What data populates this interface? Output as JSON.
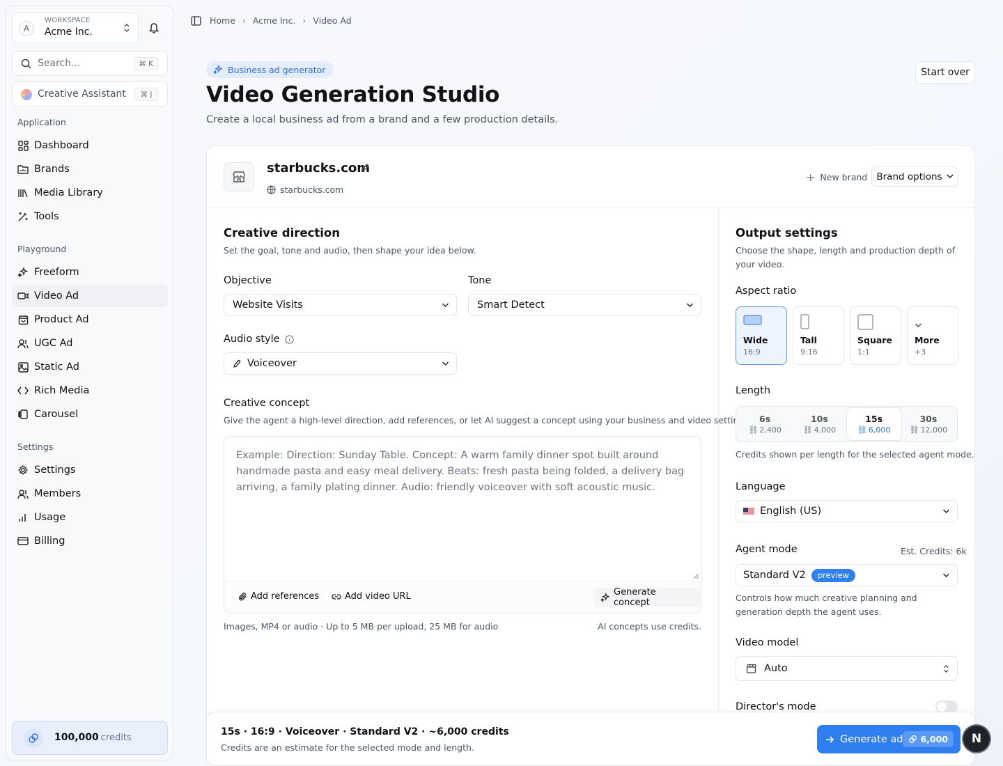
{
  "workspace": {
    "label": "WORKSPACE",
    "name": "Acme Inc.",
    "avatar": "A"
  },
  "search": {
    "placeholder": "Search...",
    "shortcut": "⌘ K"
  },
  "assistant": {
    "label": "Creative Assistant",
    "shortcut": "⌘ J"
  },
  "sidebar": {
    "application": {
      "title": "Application",
      "items": [
        {
          "label": "Dashboard",
          "icon": "dashboard-icon"
        },
        {
          "label": "Brands",
          "icon": "folder-icon"
        },
        {
          "label": "Media Library",
          "icon": "library-icon"
        },
        {
          "label": "Tools",
          "icon": "wand-icon"
        }
      ]
    },
    "playground": {
      "title": "Playground",
      "items": [
        {
          "label": "Freeform",
          "icon": "sparkles-icon"
        },
        {
          "label": "Video Ad",
          "icon": "video-icon",
          "active": true
        },
        {
          "label": "Product Ad",
          "icon": "bag-icon"
        },
        {
          "label": "UGC Ad",
          "icon": "users-icon"
        },
        {
          "label": "Static Ad",
          "icon": "image-icon"
        },
        {
          "label": "Rich Media",
          "icon": "code-icon"
        },
        {
          "label": "Carousel",
          "icon": "carousel-icon"
        }
      ]
    },
    "settings": {
      "title": "Settings",
      "items": [
        {
          "label": "Settings",
          "icon": "gear-icon"
        },
        {
          "label": "Members",
          "icon": "users-icon"
        },
        {
          "label": "Usage",
          "icon": "bar-chart-icon"
        },
        {
          "label": "Billing",
          "icon": "card-icon"
        }
      ]
    },
    "credits": {
      "amount": "100,000",
      "label": "credits"
    }
  },
  "breadcrumb": [
    "Home",
    "Acme Inc.",
    "Video Ad"
  ],
  "header": {
    "badge": "Business ad generator",
    "title": "Video Generation Studio",
    "subtitle": "Create a local business ad from a brand and a few production details.",
    "start_over": "Start over"
  },
  "brand": {
    "name": "starbucks.com",
    "url": "starbucks.com",
    "new_brand": "New brand",
    "options": "Brand options"
  },
  "creative": {
    "title": "Creative direction",
    "desc": "Set the goal, tone and audio, then shape your idea below.",
    "objective_label": "Objective",
    "objective_value": "Website Visits",
    "tone_label": "Tone",
    "tone_value": "Smart Detect",
    "audio_label": "Audio style",
    "audio_value": "Voiceover",
    "concept_label": "Creative concept",
    "concept_desc": "Give the agent a high-level direction, add references, or let AI suggest a concept using your business and video settings.",
    "concept_placeholder": "Example: Direction: Sunday Table. Concept: A warm family dinner spot built around handmade pasta and easy meal delivery. Beats: fresh pasta being folded, a delivery bag arriving, a family plating dinner. Audio: friendly voiceover with soft acoustic music.",
    "add_references": "Add references",
    "add_video_url": "Add video URL",
    "generate_concept": "Generate concept",
    "upload_hint": "Images, MP4 or audio · Up to 5 MB per upload, 25 MB for audio",
    "ai_hint": "AI concepts use credits."
  },
  "output": {
    "title": "Output settings",
    "desc": "Choose the shape, length and production depth of your video.",
    "aspect_label": "Aspect ratio",
    "aspects": [
      {
        "name": "Wide",
        "ratio": "16:9",
        "selected": true
      },
      {
        "name": "Tall",
        "ratio": "9:16"
      },
      {
        "name": "Square",
        "ratio": "1:1"
      },
      {
        "name": "More",
        "ratio": "+3"
      }
    ],
    "length_label": "Length",
    "lengths": [
      {
        "t": "6s",
        "c": "2,400"
      },
      {
        "t": "10s",
        "c": "4,000"
      },
      {
        "t": "15s",
        "c": "6,000",
        "selected": true
      },
      {
        "t": "30s",
        "c": "12,000"
      }
    ],
    "length_hint": "Credits shown per length for the selected agent mode.",
    "language_label": "Language",
    "language_value": "English (US)",
    "agent_label": "Agent mode",
    "agent_est": "Est. Credits: 6k",
    "agent_value": "Standard V2",
    "agent_badge": "preview",
    "agent_desc": "Controls how much creative planning and generation depth the agent uses.",
    "model_label": "Video model",
    "model_value": "Auto",
    "director_label": "Director's mode"
  },
  "footer": {
    "summary": "15s · 16:9 · Voiceover · Standard V2 · ~6,000 credits",
    "note": "Credits are an estimate for the selected mode and length.",
    "generate": "Generate ad",
    "generate_credits": "6,000",
    "logo": "N"
  },
  "colors": {
    "accent": "#2f7ff0",
    "badge_bg": "#e3ecfb",
    "selected_border": "#5b9af0"
  }
}
